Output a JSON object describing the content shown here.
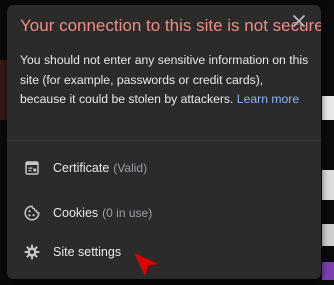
{
  "popup": {
    "title": "Your connection to this site is not secure",
    "message": "You should not enter any sensitive information on this site (for example, passwords or credit cards), because it could be stolen by attackers.",
    "learn_more": "Learn more",
    "close_icon": "close-icon"
  },
  "menu": {
    "items": [
      {
        "label": "Certificate",
        "sub": "(Valid)",
        "icon": "certificate-icon"
      },
      {
        "label": "Cookies",
        "sub": "(0 in use)",
        "icon": "cookie-icon"
      },
      {
        "label": "Site settings",
        "sub": "",
        "icon": "gear-icon"
      }
    ]
  },
  "colors": {
    "title": "#f28b82",
    "link": "#8ab4f8",
    "popup_bg": "#2b2b2b",
    "annotation_arrow": "#e00000"
  }
}
